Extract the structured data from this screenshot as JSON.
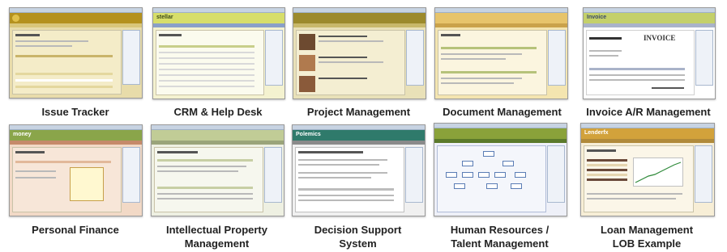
{
  "tiles": [
    {
      "caption": [
        "Issue Tracker"
      ],
      "band_color": "#b4911e",
      "logo": "",
      "theme": "#e8dcaa"
    },
    {
      "caption": [
        "CRM & Help Desk"
      ],
      "band_color": "#d7de6a",
      "logo": "stellar",
      "theme": "#f4f2d0"
    },
    {
      "caption": [
        "Project Management"
      ],
      "band_color": "#9c8a2c",
      "logo": "",
      "theme": "#e9e1b8"
    },
    {
      "caption": [
        "Document Management"
      ],
      "band_color": "#e7c46b",
      "logo": "",
      "theme": "#f4e5b0"
    },
    {
      "caption": [
        "Invoice A/R Management"
      ],
      "band_color": "#c4d06a",
      "logo": "Invoice",
      "theme": "#ffffff"
    },
    {
      "caption": [
        "Personal Finance"
      ],
      "band_color": "#8aa54a",
      "logo": "money",
      "theme": "#f2d9c6"
    },
    {
      "caption": [
        "Intellectual Property",
        "Management"
      ],
      "band_color": "#c1cc96",
      "logo": "",
      "theme": "#eef0e2"
    },
    {
      "caption": [
        "Decision Support",
        "System"
      ],
      "band_color": "#2f7a6b",
      "logo": "Polemics",
      "theme": "#f0f0f0"
    },
    {
      "caption": [
        "Human Resources /",
        "Talent Management"
      ],
      "band_color": "#8aa23a",
      "logo": "",
      "theme": "#eef0f8"
    },
    {
      "caption": [
        "Loan Management",
        "LOB Example"
      ],
      "band_color": "#d2a23b",
      "logo": "Lenderfx",
      "theme": "#f7eed6"
    }
  ],
  "invoice_heading": "INVOICE"
}
